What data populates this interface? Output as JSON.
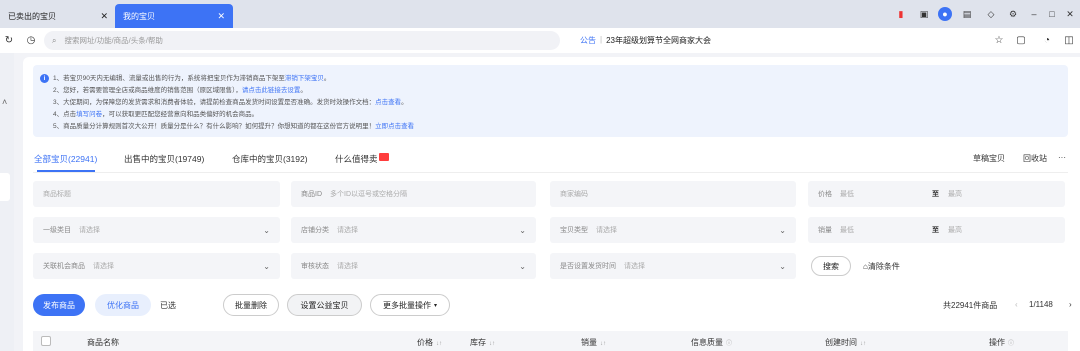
{
  "browser": {
    "tabs": [
      {
        "label": "已卖出的宝贝",
        "active": false
      },
      {
        "label": "我的宝贝",
        "active": true
      }
    ],
    "url_placeholder": "搜索网址/功能/商品/头条/帮助",
    "notice_label": "公告",
    "notice_text": "23年超级划算节全网商家大会"
  },
  "info": {
    "lines": [
      {
        "num": "1、",
        "text": "若宝贝90天内无编辑、流量或出售的行为，系统将把宝贝作为滞销商品下架至",
        "link": "滞销下架宝贝",
        "tail": "。"
      },
      {
        "num": "2、",
        "text": "您好，若需要管理全店或商品维度的销售范围（原区域限售），",
        "link": "请点击此链接去设置",
        "tail": "。"
      },
      {
        "num": "3、",
        "text": "大促期间，为保障您的发货需求和消费者体验，请提前检查商品发货时间设置是否准确。发货时效操作文档：",
        "link": "点击查看",
        "tail": "。"
      },
      {
        "num": "4、",
        "text": "点击",
        "link": "填写问卷",
        "tail": "，可以获取更匹配您经营意向和品类偏好的机会商品。"
      },
      {
        "num": "5、",
        "text": "商品质量分计算规则首次大公开！质量分是什么？有什么影响？如何提升？你想知道的都在这份官方说明里！",
        "link": "立即点击查看",
        "tail": ""
      }
    ]
  },
  "tabs": [
    {
      "label": "全部宝贝(22941)"
    },
    {
      "label": "出售中的宝贝(19749)"
    },
    {
      "label": "仓库中的宝贝(3192)"
    },
    {
      "label": "什么值得卖"
    }
  ],
  "right_links": {
    "draft": "草稿宝贝",
    "recycle": "回收站",
    "more": "···"
  },
  "filters": {
    "title": {
      "label": "",
      "placeholder": "商品标题"
    },
    "id": {
      "label": "商品ID",
      "placeholder": "多个ID以逗号或空格分隔"
    },
    "code": {
      "label": "",
      "placeholder": "商家编码"
    },
    "price": {
      "label": "价格",
      "low": "最低",
      "to": "至",
      "high": "最高"
    },
    "cat1": {
      "label": "一级类目",
      "placeholder": "请选择"
    },
    "shopcat": {
      "label": "店铺分类",
      "placeholder": "请选择"
    },
    "type": {
      "label": "宝贝类型",
      "placeholder": "请选择"
    },
    "sales": {
      "label": "销量",
      "low": "最低",
      "to": "至",
      "high": "最高"
    },
    "opp": {
      "label": "关联机会商品",
      "placeholder": "请选择"
    },
    "audit": {
      "label": "审核状态",
      "placeholder": "请选择"
    },
    "ship": {
      "label": "是否设置发货时间",
      "placeholder": "请选择"
    }
  },
  "actions": {
    "search": "搜索",
    "clear": "清除条件",
    "publish": "发布商品",
    "optimize": "优化商品",
    "selected": "已选",
    "batch_delete": "批量删除",
    "charity": "设置公益宝贝",
    "more_batch": "更多批量操作",
    "total": "共22941件商品",
    "page": "1/1148"
  },
  "table": {
    "headers": [
      "商品名称",
      "价格",
      "库存",
      "销量",
      "信息质量",
      "创建时间",
      "操作"
    ]
  },
  "colors": {
    "accent": "#3d73f5",
    "hot": "#ff3d3d"
  }
}
